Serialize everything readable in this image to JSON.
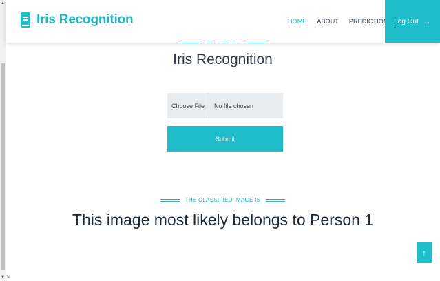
{
  "header": {
    "brand": "Iris Recognition",
    "nav": [
      {
        "label": "HOME",
        "active": true
      },
      {
        "label": "ABOUT",
        "active": false
      },
      {
        "label": "PREDICTIONS",
        "active": false
      }
    ],
    "logout_label": "Log Out",
    "logout_icon": "→"
  },
  "upload_section": {
    "tag": "GET RESULT",
    "title": "Iris Recognition",
    "file_button": "Choose File",
    "file_status": "No file chosen",
    "submit_label": "Submit"
  },
  "result_section": {
    "tag": "THE CLASSIFIED IMAGE IS",
    "result_text": "This image most likely belongs to Person 1"
  },
  "back_to_top_icon": "↑",
  "scrollbar": {
    "up_glyph": "▲",
    "down_glyph": "▼",
    "corner_glyph": "⇲"
  },
  "colors": {
    "accent": "#1fbcca",
    "text_dark": "#2e3a4a"
  }
}
